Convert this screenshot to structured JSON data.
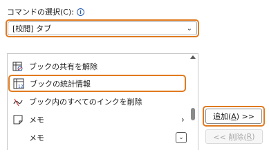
{
  "command_select": {
    "label": "コマンドの選択(C):",
    "value": "[校閲] タブ"
  },
  "list": {
    "items": [
      {
        "label": "ブックの共有を解除",
        "icon": "unshare-workbook-icon"
      },
      {
        "label": "ブックの統計情報",
        "icon": "workbook-statistics-icon",
        "selected": true
      },
      {
        "label": "ブック内のすべてのインクを削除",
        "icon": "delete-all-ink-icon"
      },
      {
        "label": "メモ",
        "icon": "note-icon",
        "submenu": true
      },
      {
        "label": "メモ",
        "icon": "note-dropdown-icon"
      }
    ]
  },
  "buttons": {
    "add_prefix": "追加(",
    "add_key": "A",
    "add_suffix": ") >>",
    "remove_prefix": "<< 削除(",
    "remove_key": "R",
    "remove_suffix": ")"
  },
  "colors": {
    "highlight": "#e07a1f",
    "info": "#2a5db0"
  }
}
